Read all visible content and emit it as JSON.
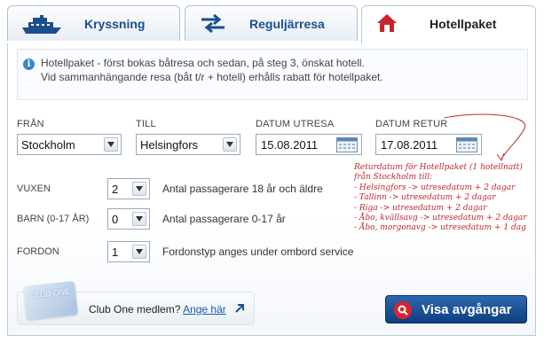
{
  "tabs": [
    {
      "label": "Kryssning",
      "icon": "ship-icon"
    },
    {
      "label": "Reguljärresa",
      "icon": "swap-arrows-icon"
    },
    {
      "label": "Hotellpaket",
      "icon": "house-icon",
      "active": true
    }
  ],
  "info": {
    "line1": "Hotellpaket - först bokas båtresa och sedan, på steg 3, önskat hotell.",
    "line2": "Vid sammanhängande resa (båt t/r + hotell) erhålls rabatt för hotellpaket."
  },
  "fields": {
    "from": {
      "label": "FRÅN",
      "value": "Stockholm"
    },
    "to": {
      "label": "TILL",
      "value": "Helsingfors"
    },
    "depart": {
      "label": "DATUM UTRESA",
      "value": "15.08.2011"
    },
    "return": {
      "label": "DATUM RETUR",
      "value": "17.08.2011"
    }
  },
  "passengers": {
    "adults": {
      "label": "VUXEN",
      "value": "2",
      "desc": "Antal passagerare 18 år och äldre"
    },
    "children": {
      "label": "BARN (0-17 ÅR)",
      "value": "0",
      "desc": "Antal passagerare 0-17 år"
    },
    "vehicle": {
      "label": "FORDON",
      "value": "1",
      "desc": "Fordonstyp anges under ombord service"
    }
  },
  "annotation": "Returdatum för Hotellpaket (1 hotellnatt)\nfrån Stockholm till:\n- Helsingfors -> utresedatum + 2 dagar\n- Tallinn -> utresedatum + 2 dagar\n- Riga -> utresedatum + 2 dagar\n- Åbo, kvällsavg -> utresedatum + 2 dagar\n- Åbo, morgonavg -> utresedatum + 1 dag",
  "club": {
    "card_text": "CLUB ONE",
    "question": "Club One medlem?",
    "link": "Ange här"
  },
  "search_button": "Visa avgångar",
  "colors": {
    "brand_blue": "#1a4f8c",
    "accent_red": "#d9262e",
    "annotation_red": "#c2272d"
  }
}
